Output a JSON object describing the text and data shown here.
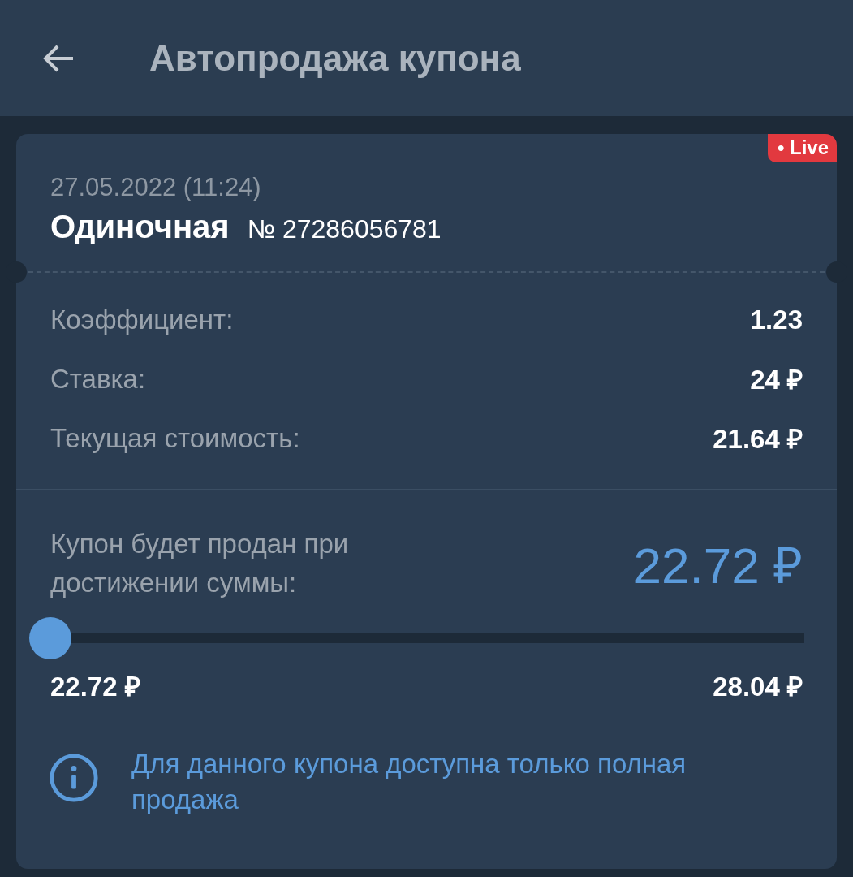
{
  "header": {
    "title": "Автопродажа купона"
  },
  "coupon": {
    "live_badge": "• Live",
    "date": "27.05.2022 (11:24)",
    "type": "Одиночная",
    "number": "№ 27286056781",
    "rows": [
      {
        "label": "Коэффициент:",
        "value": "1.23"
      },
      {
        "label": "Ставка:",
        "value": "24 ₽"
      },
      {
        "label": "Текущая стоимость:",
        "value": "21.64 ₽"
      }
    ],
    "sell_label": "Купон будет продан при достижении суммы:",
    "sell_value": "22.72 ₽",
    "slider": {
      "level": 0,
      "min_label": "22.72 ₽",
      "max_label": "28.04 ₽"
    },
    "info": "Для данного купона доступна только полная продажа"
  }
}
